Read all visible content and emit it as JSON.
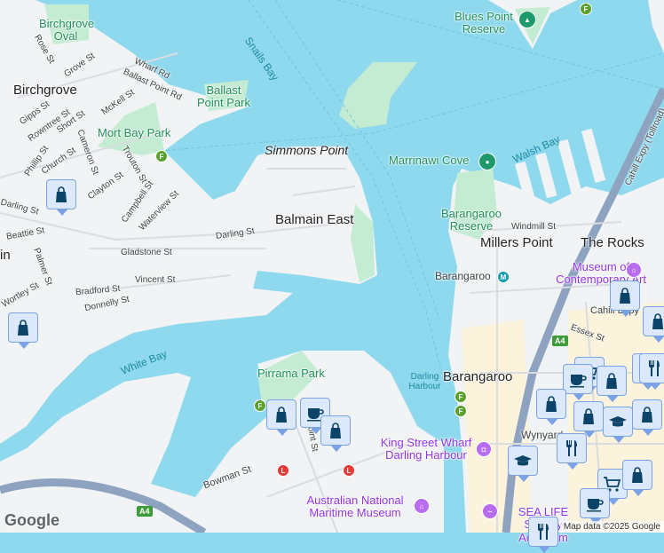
{
  "suburbs": [
    "Birchgrove",
    "Balmain East",
    "Millers Point",
    "The Rocks",
    "Barangaroo",
    "in"
  ],
  "parks": [
    "Birchgrove Oval",
    "Ballast Point Park",
    "Mort Bay Park",
    "Blues Point Reserve",
    "Barangaroo Reserve",
    "Pirrama Park",
    "Marrinawi Cove"
  ],
  "water": [
    "Snails Bay",
    "Walsh Bay",
    "White Bay",
    "Darling Harbour"
  ],
  "places": [
    "Simmons Point",
    "Barangaroo"
  ],
  "pois": [
    "Museum of Contemporary Art",
    "King Street Wharf Darling Harbour",
    "Australian National Maritime Museum",
    "SEA LIFE Sydney Aquarium",
    "Wynyard"
  ],
  "streets": [
    "Rose St",
    "Grove St",
    "Wharf Rd",
    "Ballast Point Rd",
    "McKell St",
    "Gipps St",
    "Rowntree St",
    "Short St",
    "Cameron St",
    "Phillip St",
    "Church St",
    "Trouton St",
    "Clayton St",
    "Campbell St",
    "Waterview St",
    "Darling St",
    "Darling St",
    "Beattie St",
    "Gladstone St",
    "Palmer St",
    "Wortley St",
    "Bradford St",
    "Vincent St",
    "Donnelly St",
    "Bowman St",
    "Windmill St",
    "Cahill Expy (Tollroad)",
    "Cahill Expy",
    "Essex St",
    "Point St"
  ],
  "route_shield": "A4",
  "attribution": "Map data ©2025 Google",
  "logo": "Google",
  "colors": {
    "water": "#8fd9ee",
    "land": "#f1f3f4",
    "park": "#c4ecd2",
    "highway": "#8ea3c0",
    "pin": "#dce8fb",
    "pin_icon": "#0b4468"
  }
}
